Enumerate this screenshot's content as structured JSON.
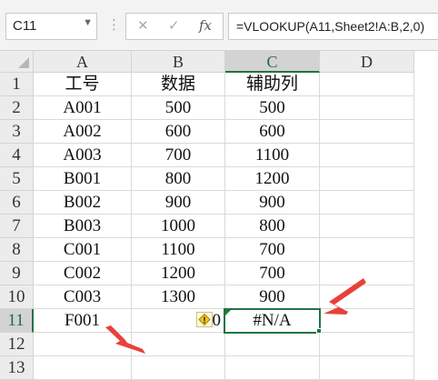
{
  "name_box": {
    "value": "C11",
    "dropdown_icon": "chevron-down-icon"
  },
  "formula_bar": {
    "cancel_icon": "✕",
    "enter_icon": "✓",
    "fx_label": "fx",
    "formula": "=VLOOKUP(A11,Sheet2!A:B,2,0)"
  },
  "columns": [
    "A",
    "B",
    "C",
    "D"
  ],
  "rows": [
    "1",
    "2",
    "3",
    "4",
    "5",
    "6",
    "7",
    "8",
    "9",
    "10",
    "11",
    "12",
    "13"
  ],
  "cells": [
    [
      "工号",
      "数据",
      "辅助列",
      ""
    ],
    [
      "A001",
      "500",
      "500",
      ""
    ],
    [
      "A002",
      "600",
      "600",
      ""
    ],
    [
      "A003",
      "700",
      "1100",
      ""
    ],
    [
      "B001",
      "800",
      "1200",
      ""
    ],
    [
      "B002",
      "900",
      "900",
      ""
    ],
    [
      "B003",
      "1000",
      "800",
      ""
    ],
    [
      "C001",
      "1100",
      "700",
      ""
    ],
    [
      "C002",
      "1200",
      "700",
      ""
    ],
    [
      "C003",
      "1300",
      "900",
      ""
    ],
    [
      "F001",
      "100",
      "#N/A",
      ""
    ],
    [
      "",
      "",
      "",
      ""
    ],
    [
      "",
      "",
      "",
      ""
    ]
  ],
  "active_cell": "C11",
  "colors": {
    "selection": "#217346",
    "annotation_arrow": "#e8413a"
  },
  "icons": {
    "error_indicator": "warning-diamond-icon",
    "error_flag": "green-triangle-icon"
  }
}
